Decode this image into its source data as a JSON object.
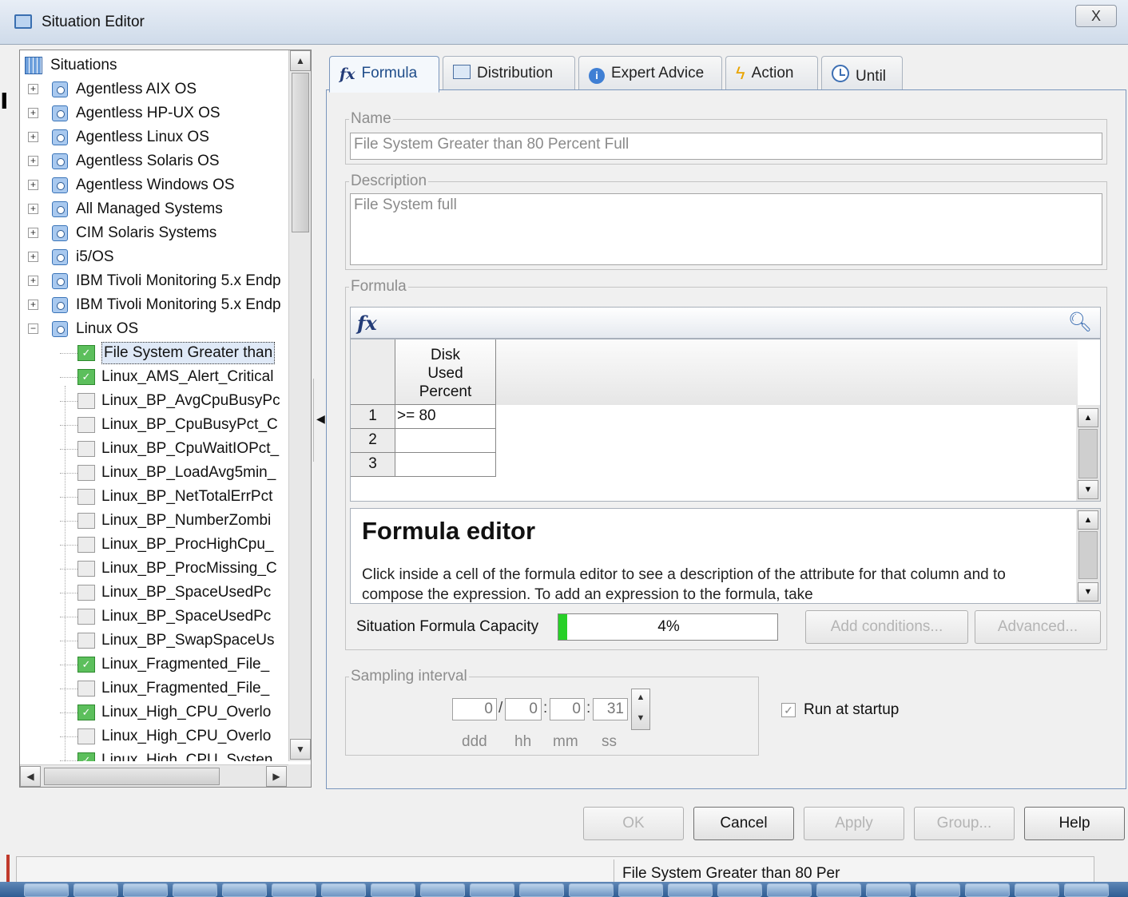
{
  "window": {
    "title": "Situation Editor",
    "close_label": "X"
  },
  "left_mark": "ı",
  "tree": {
    "root": "Situations",
    "systems": [
      {
        "label": "Agentless AIX OS",
        "expanded": false
      },
      {
        "label": "Agentless HP-UX OS",
        "expanded": false
      },
      {
        "label": "Agentless Linux OS",
        "expanded": false
      },
      {
        "label": "Agentless Solaris OS",
        "expanded": false
      },
      {
        "label": "Agentless Windows OS",
        "expanded": false
      },
      {
        "label": "All Managed Systems",
        "expanded": false
      },
      {
        "label": "CIM Solaris Systems",
        "expanded": false
      },
      {
        "label": "i5/OS",
        "expanded": false
      },
      {
        "label": "IBM Tivoli Monitoring 5.x Endp",
        "expanded": false
      },
      {
        "label": "IBM Tivoli Monitoring 5.x Endp",
        "expanded": false
      },
      {
        "label": "Linux OS",
        "expanded": true
      }
    ],
    "situations": [
      {
        "label": "File System Greater than",
        "active": true,
        "selected": true
      },
      {
        "label": "Linux_AMS_Alert_Critical",
        "active": true
      },
      {
        "label": "Linux_BP_AvgCpuBusyPc",
        "active": false
      },
      {
        "label": "Linux_BP_CpuBusyPct_C",
        "active": false
      },
      {
        "label": "Linux_BP_CpuWaitIOPct_",
        "active": false
      },
      {
        "label": "Linux_BP_LoadAvg5min_",
        "active": false
      },
      {
        "label": "Linux_BP_NetTotalErrPct",
        "active": false
      },
      {
        "label": "Linux_BP_NumberZombi",
        "active": false
      },
      {
        "label": "Linux_BP_ProcHighCpu_",
        "active": false
      },
      {
        "label": "Linux_BP_ProcMissing_C",
        "active": false
      },
      {
        "label": "Linux_BP_SpaceUsedPc",
        "active": false
      },
      {
        "label": "Linux_BP_SpaceUsedPc",
        "active": false
      },
      {
        "label": "Linux_BP_SwapSpaceUs",
        "active": false
      },
      {
        "label": "Linux_Fragmented_File_",
        "active": true
      },
      {
        "label": "Linux_Fragmented_File_",
        "active": false
      },
      {
        "label": "Linux_High_CPU_Overlo",
        "active": true
      },
      {
        "label": "Linux_High_CPU_Overlo",
        "active": false
      },
      {
        "label": "Linux_High_CPU_Systen",
        "active": true
      }
    ]
  },
  "tabs": [
    {
      "label": "Formula",
      "icon": "fx-icon",
      "active": true
    },
    {
      "label": "Distribution",
      "icon": "distribution-icon"
    },
    {
      "label": "Expert Advice",
      "icon": "info-icon"
    },
    {
      "label": "Action",
      "icon": "lightning-icon"
    },
    {
      "label": "Until",
      "icon": "clock-icon"
    }
  ],
  "formula_tab": {
    "name_legend": "Name",
    "name_value": "File System Greater than 80 Percent Full",
    "description_legend": "Description",
    "description_value": "File System full",
    "formula_legend": "Formula",
    "fx_symbol": "fx",
    "column_header": [
      "Disk",
      "Used",
      "Percent"
    ],
    "rows": [
      {
        "num": "1",
        "value": ">= 80"
      },
      {
        "num": "2",
        "value": ""
      },
      {
        "num": "3",
        "value": ""
      }
    ],
    "help_title": "Formula editor",
    "help_text": "Click inside a cell of the formula editor to see a description of the attribute for that column and to compose the expression. To add an expression to the formula, take",
    "capacity_label": "Situation Formula Capacity",
    "capacity_percent": 4,
    "capacity_text": "4%",
    "add_conditions_label": "Add conditions...",
    "advanced_label": "Advanced...",
    "sampling_legend": "Sampling interval",
    "sampling": {
      "ddd": "0",
      "hh": "0",
      "mm": "0",
      "ss": "31"
    },
    "sampling_units": {
      "ddd": "ddd",
      "hh": "hh",
      "mm": "mm",
      "ss": "ss"
    },
    "run_at_startup_label": "Run at startup",
    "run_at_startup_checked": true
  },
  "buttons": {
    "ok": "OK",
    "cancel": "Cancel",
    "apply": "Apply",
    "group": "Group...",
    "help": "Help"
  },
  "status_text": "File System Greater than 80 Per",
  "colors": {
    "capacity_fill": "#27d027",
    "active_tab_text": "#1f4d8a"
  }
}
